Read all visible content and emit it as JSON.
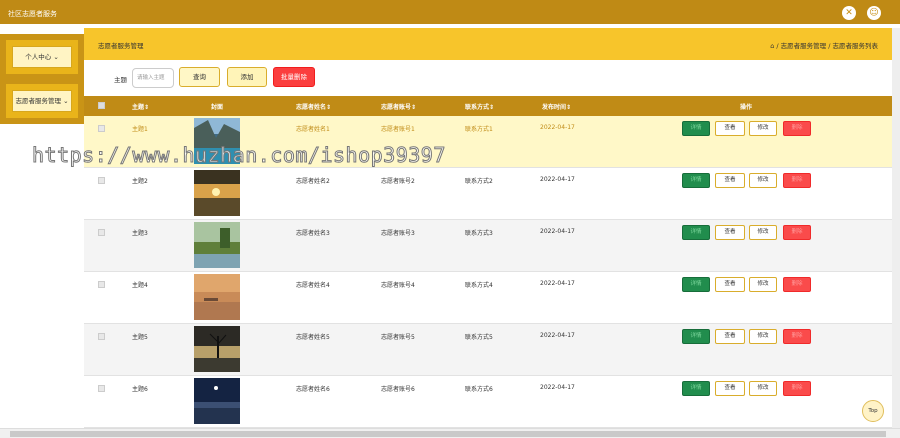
{
  "app": {
    "title": "社区志愿者服务"
  },
  "sidebar": {
    "items": [
      {
        "label": "个人中心",
        "arrow": "⌄"
      },
      {
        "label": "志愿者服务管理",
        "arrow": "⌄"
      }
    ]
  },
  "breadcrumb": {
    "section": "志愿者服务管理",
    "path": "⌂ / 志愿者服务管理 / 志愿者服务列表"
  },
  "search": {
    "label": "主题",
    "placeholder": "请输入主题",
    "query_label": "查询",
    "add_label": "添加",
    "batch_delete_label": "批量删除"
  },
  "table": {
    "headers": {
      "subject": "主题⇕",
      "cover": "封面",
      "vname": "志愿者姓名⇕",
      "vaccount": "志愿者账号⇕",
      "contact": "联系方式⇕",
      "time": "发布时间⇕",
      "ops": "操作"
    },
    "rows": [
      {
        "subject": "主题1",
        "vname": "志愿者姓名1",
        "vaccount": "志愿者账号1",
        "contact": "联系方式1",
        "time": "2022-04-17"
      },
      {
        "subject": "主题2",
        "vname": "志愿者姓名2",
        "vaccount": "志愿者账号2",
        "contact": "联系方式2",
        "time": "2022-04-17"
      },
      {
        "subject": "主题3",
        "vname": "志愿者姓名3",
        "vaccount": "志愿者账号3",
        "contact": "联系方式3",
        "time": "2022-04-17"
      },
      {
        "subject": "主题4",
        "vname": "志愿者姓名4",
        "vaccount": "志愿者账号4",
        "contact": "联系方式4",
        "time": "2022-04-17"
      },
      {
        "subject": "主题5",
        "vname": "志愿者姓名5",
        "vaccount": "志愿者账号5",
        "contact": "联系方式5",
        "time": "2022-04-17"
      },
      {
        "subject": "主题6",
        "vname": "志愿者姓名6",
        "vaccount": "志愿者账号6",
        "contact": "联系方式6",
        "time": "2022-04-17"
      }
    ],
    "ops": {
      "detail": "详情",
      "view": "查看",
      "edit": "修改",
      "delete": "删除"
    }
  },
  "watermark": "https://www.huzhan.com/ishop39397",
  "top_button": "Top",
  "colors": {
    "header": "#bf8a15",
    "accent": "#f7c52b",
    "danger": "#fb3e3e",
    "success": "#218d4d"
  }
}
